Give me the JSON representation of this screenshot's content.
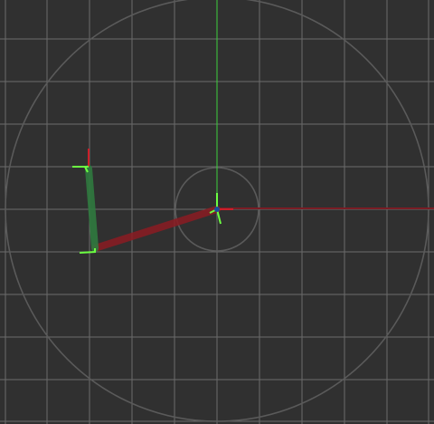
{
  "viewport": {
    "background": "#303030",
    "grid_color": "#6b6b6b",
    "ring_color": "#5a5a5a",
    "axis_x_color": "#7a1d25",
    "axis_y_color": "#3bd13b",
    "bone_upper_color": "#8b1b22",
    "bone_lower_color": "#2f7a3f",
    "gizmo_x_color": "#cc1f2a",
    "gizmo_y_color": "#6cff42",
    "gizmo_z_color": "#1b4d9c"
  },
  "icons": {
    "origin": "origin-gizmo-icon",
    "joint_elbow": "elbow-joint-gizmo-icon",
    "joint_wrist": "wrist-joint-gizmo-icon"
  }
}
